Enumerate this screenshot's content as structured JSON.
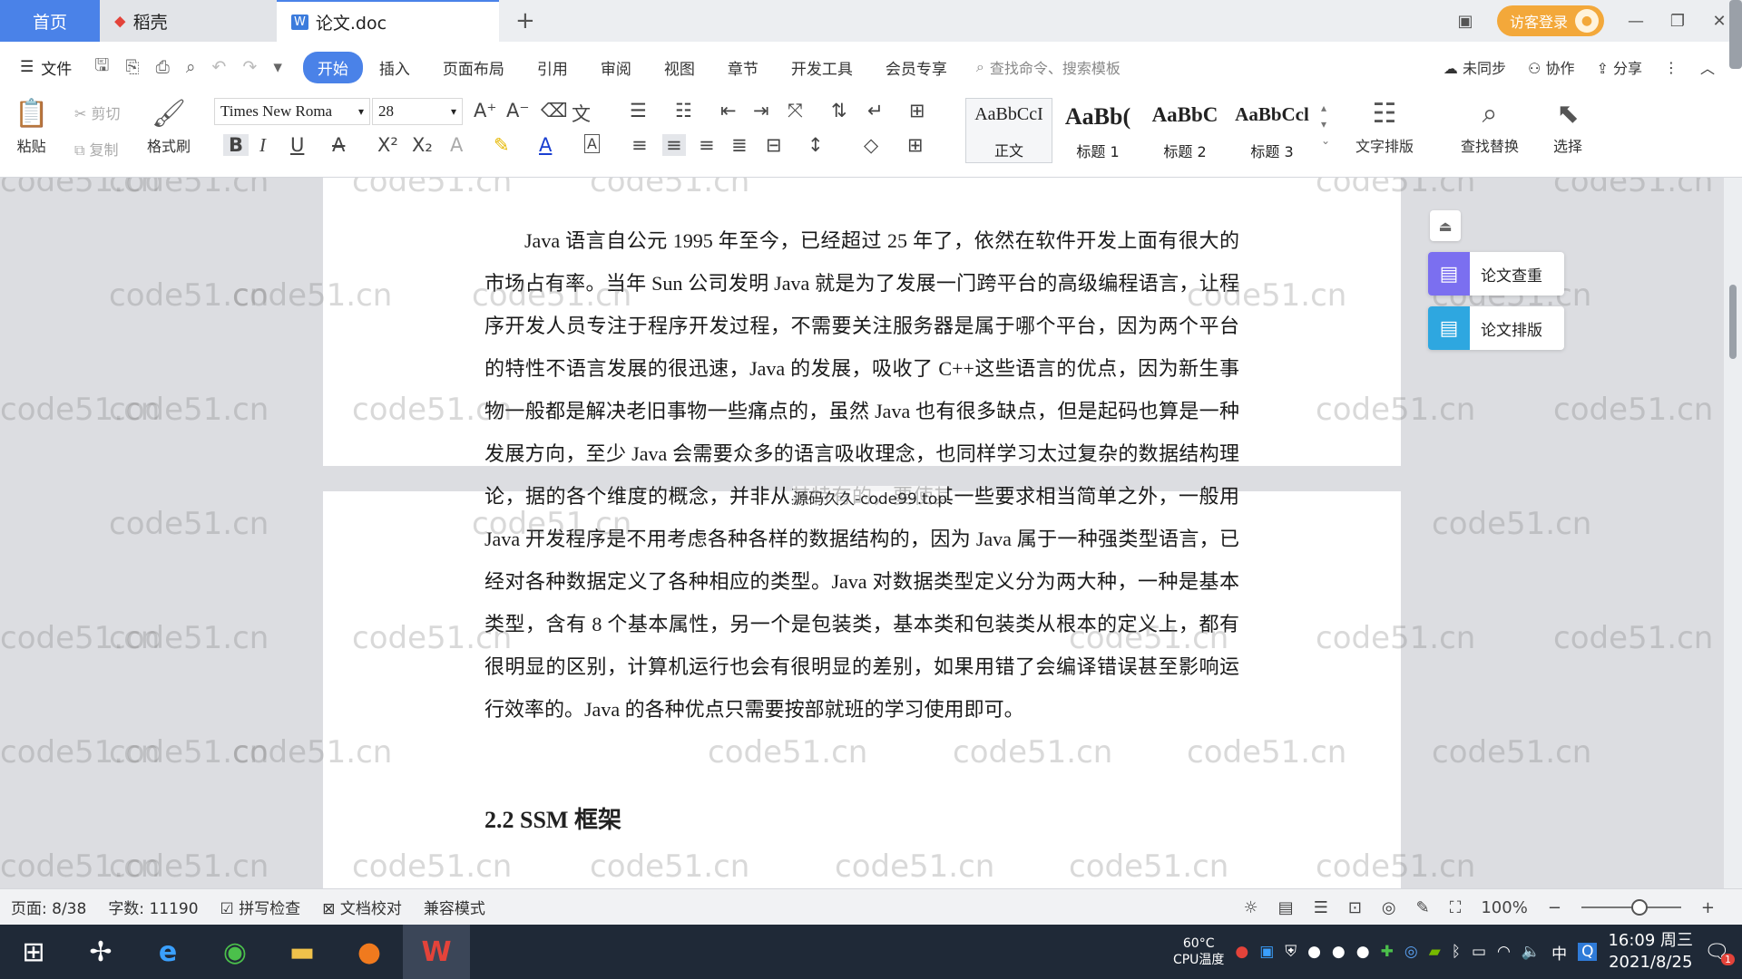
{
  "tabs": {
    "home": "首页",
    "t1": "稻壳",
    "t2": "论文.doc",
    "visitor_login": "访客登录"
  },
  "menu": {
    "file": "文件",
    "items": [
      "开始",
      "插入",
      "页面布局",
      "引用",
      "审阅",
      "视图",
      "章节",
      "开发工具",
      "会员专享"
    ],
    "search_placeholder": "查找命令、搜索模板",
    "unsync": "未同步",
    "collab": "协作",
    "share": "分享"
  },
  "ribbon": {
    "paste": "粘贴",
    "cut": "剪切",
    "copy": "复制",
    "format_painter": "格式刷",
    "font_name": "Times New Roma",
    "font_size": "28",
    "styles": [
      {
        "preview": "AaBbCcI",
        "label": "正文"
      },
      {
        "preview": "AaBb(",
        "label": "标题 1"
      },
      {
        "preview": "AaBbC",
        "label": "标题 2"
      },
      {
        "preview": "AaBbCcl",
        "label": "标题 3"
      }
    ],
    "text_layout": "文字排版",
    "find_replace": "查找替换",
    "select": "选择"
  },
  "document": {
    "para1": "Java 语言自公元 1995 年至今，已经超过 25 年了，依然在软件开发上面有很大的市场占有率。当年 Sun 公司发明 Java 就是为了发展一门跨平台的高级编程语言，让程序开发人员专注于程序开发过程，不需要关注服务器是属于哪个平台，因为两个平台的特性不语言发展的很迅速，Java 的发展，吸收了 C++这些语言的优点，因为新生事物一般都是解决老旧事物一些痛点的，虽然 Java 也有很多缺点，但是起码也算是一种发展方向，至少 Java 会需要众多的语言吸收理念，也同样学习太过复杂的数据结构理论，据的各个维度的概念，并非从其特有的，要使其一些要求相当简单之外，一般用 Java 开发程序是不用考虑各种各样的数据结构的，因为 Java 属于一种强类型语言，已经对各种数据定义了各种相应的类型。Java 对数据类型定义分为两大种，一种是基本类型，含有 8 个基本属性，另一个是包装类，基本类和包装类从根本的定义上，都有很明显的区别，计算机运行也会有很明显的差别，如果用错了会编译错误甚至影响运行效率的。Java 的各种优点只需要按部就班的学习使用即可。",
    "overlay_text": "源码久久-code99.top",
    "heading": "2.2 SSM 框架",
    "side_check": "论文查重",
    "side_layout": "论文排版",
    "watermark": "code51.cn"
  },
  "status": {
    "page": "页面: 8/38",
    "words": "字数: 11190",
    "spell": "拼写检查",
    "proof": "文档校对",
    "compat": "兼容模式",
    "zoom": "100%",
    "zoom_level": 0.5
  },
  "taskbar": {
    "cpu_temp": "60°C",
    "cpu_label": "CPU温度",
    "ime": "中",
    "time": "16:09 周三",
    "date": "2021/8/25",
    "notif_count": "1"
  }
}
